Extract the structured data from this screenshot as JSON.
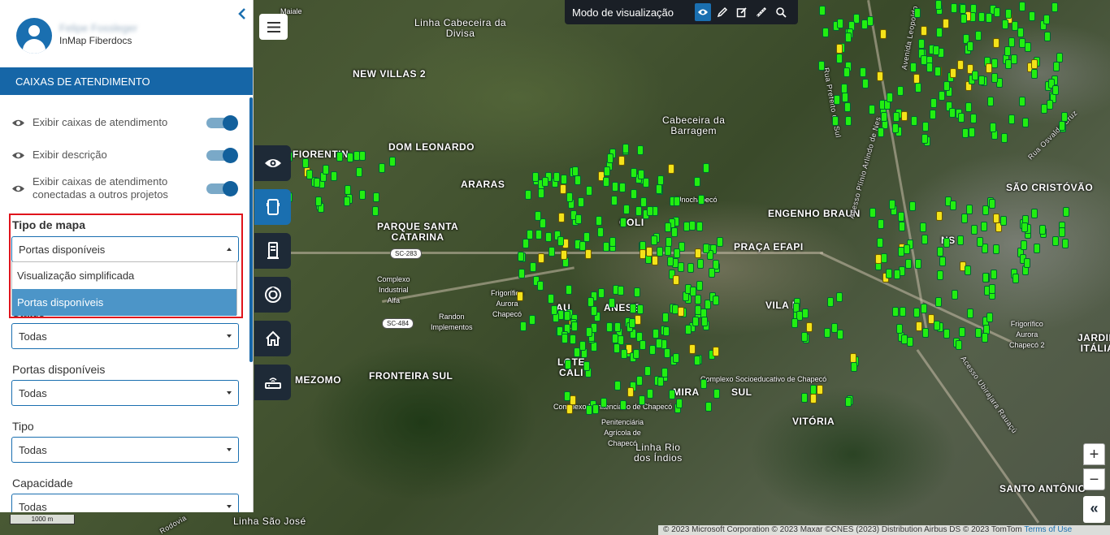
{
  "toolbar": {
    "title": "Modo de visualização",
    "buttons": [
      "eye-icon",
      "pencil-icon",
      "edit-icon",
      "ruler-icon",
      "search-icon"
    ]
  },
  "sidebar": {
    "user_name": "Felipe Fossleger",
    "org": "InMap Fiberdocs",
    "section_title": "CAIXAS DE ATENDIMENTO",
    "toggles": [
      {
        "label": "Exibir caixas de atendimento",
        "on": true
      },
      {
        "label": "Exibir descrição",
        "on": true
      },
      {
        "label": "Exibir caixas de atendimento conectadas a outros projetos",
        "on": true
      }
    ],
    "map_type": {
      "label": "Tipo de mapa",
      "value": "Portas disponíveis",
      "options": [
        "Visualização simplificada",
        "Portas disponíveis"
      ]
    },
    "filters": [
      {
        "label": "Status",
        "value": "Todas"
      },
      {
        "label": "Portas disponíveis",
        "value": "Todas"
      },
      {
        "label": "Tipo",
        "value": "Todas"
      },
      {
        "label": "Capacidade",
        "value": "Todas"
      }
    ]
  },
  "rail": [
    "eye-icon",
    "box-icon",
    "cabinet-icon",
    "splice-icon",
    "home-icon",
    "router-icon"
  ],
  "map": {
    "labels": [
      "Maiale",
      "Linha Cabeceira da Divisa",
      "NEW VILLAS 2",
      "Cabeceira da Barragem",
      "FIORENTIN",
      "DOM LEONARDO",
      "ARARAS",
      "Unochapecó",
      "ENGENHO BRAUN",
      "SÃO CRISTÓVÃO",
      "PARQUE SANTA CATARINA",
      "PRAÇA EFAPI",
      "Complexo Industrial Alfa",
      "Frigorífico Aurora Chapecó",
      "Randon Implementos",
      "VILA R",
      "Frigorífico Aurora Chapecó 2",
      "JARDIM ITÁLIA",
      "MEZOMO",
      "FRONTEIRA SUL",
      "Complexo Socioeducativo de Chapecó",
      "Complexo Penitenciário de Chapecó",
      "Penitenciária Agrícola de Chapecó",
      "Linha Rio dos Índios",
      "VITÓRIA",
      "SANTO ANTÔNIO",
      "Linha São José",
      "Avenida Leopoldo",
      "Rua Prefeito do Sul",
      "Acesso Plínio Arlindo de Nes",
      "Rua Osvaldo Cruz",
      "Acesso Ubirajara Rauaçú",
      "Rodovia",
      "LOTE",
      "CALI",
      "MIRA",
      "SUL",
      "ANESE",
      "COLI",
      "AU",
      "NS"
    ],
    "shields": [
      "SC-283",
      "SC-484"
    ],
    "scale": "1000 m",
    "attribution": "© 2023 Microsoft Corporation © 2023 Maxar ©CNES (2023) Distribution Airbus DS © 2023 TomTom",
    "terms": "Terms of Use",
    "zoom_in": "+",
    "zoom_out": "−",
    "expand": "«"
  }
}
